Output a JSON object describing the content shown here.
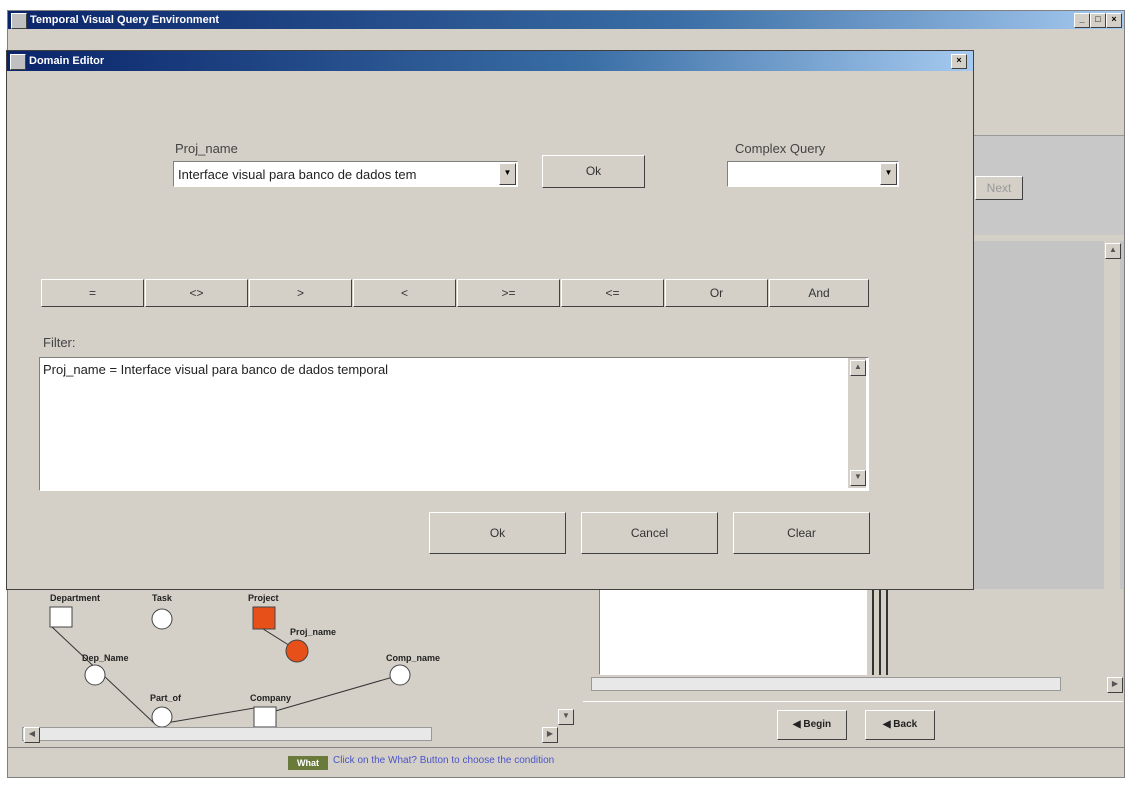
{
  "main_window": {
    "title": "Temporal Visual Query Environment",
    "controls": [
      "_",
      "□",
      "×"
    ]
  },
  "dialog": {
    "title": "Domain Editor",
    "close": "×",
    "field_label": "Proj_name",
    "field_value": "Interface visual para banco de dados tem",
    "ok_top": "Ok",
    "complex_label": "Complex Query",
    "complex_value": "",
    "operators": [
      "=",
      "<>",
      ">",
      "<",
      ">=",
      "<=",
      "Or",
      "And"
    ],
    "filter_label": "Filter:",
    "filter_text": "Proj_name = Interface visual para banco de dados temporal",
    "buttons": {
      "ok": "Ok",
      "cancel": "Cancel",
      "clear": "Clear"
    }
  },
  "background": {
    "right_button": "Next",
    "nav": {
      "begin": "Begin",
      "back": "Back"
    },
    "schema_nodes": {
      "department": "Department",
      "task": "Task",
      "project": "Project",
      "proj_name": "Proj_name",
      "dep_name": "Dep_Name",
      "comp_name": "Comp_name",
      "part_of": "Part_of",
      "company": "Company"
    },
    "status_tag": "What",
    "status_text": "Click on the What? Button to choose the condition"
  },
  "colors": {
    "entity_selected": "#e8501a",
    "titlebar": "#0a246a",
    "status_text": "#4a54c8"
  }
}
